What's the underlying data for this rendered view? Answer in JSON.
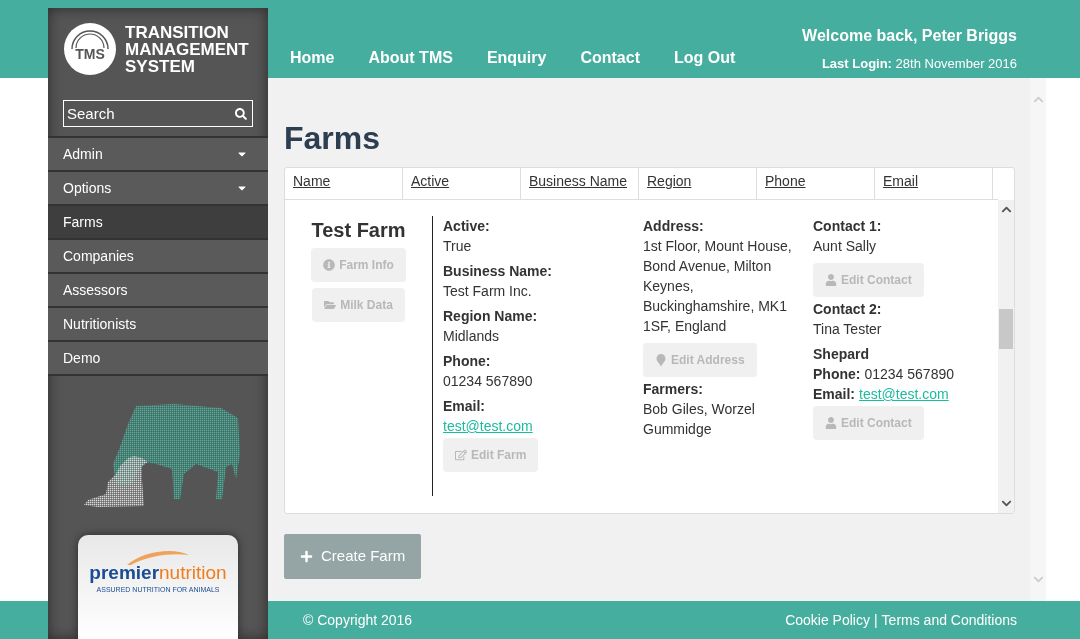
{
  "logo": {
    "badge": "TMS",
    "lines": [
      "TRANSITION",
      "MANAGEMENT",
      "SYSTEM"
    ]
  },
  "search": {
    "placeholder": "Search"
  },
  "sidebar": {
    "items": [
      {
        "label": "Admin",
        "has_menu": true,
        "selected": false
      },
      {
        "label": "Options",
        "has_menu": true,
        "selected": false
      },
      {
        "label": "Farms",
        "has_menu": false,
        "selected": true
      },
      {
        "label": "Companies",
        "has_menu": false,
        "selected": false
      },
      {
        "label": "Assessors",
        "has_menu": false,
        "selected": false
      },
      {
        "label": "Nutritionists",
        "has_menu": false,
        "selected": false
      },
      {
        "label": "Demo",
        "has_menu": false,
        "selected": false
      }
    ]
  },
  "sponsor": {
    "word_1": "premier",
    "word_2": "nutrition",
    "tagline": "ASSURED NUTRITION FOR ANIMALS"
  },
  "nav": [
    {
      "label": "Home"
    },
    {
      "label": "About TMS"
    },
    {
      "label": "Enquiry"
    },
    {
      "label": "Contact"
    },
    {
      "label": "Log Out"
    }
  ],
  "user": {
    "welcome": "Welcome back, Peter Briggs",
    "last_login_label": "Last Login:",
    "last_login": "28th November 2016"
  },
  "page_title": "Farms",
  "table": {
    "columns": [
      "Name",
      "Active",
      "Business Name",
      "Region",
      "Phone",
      "Email"
    ]
  },
  "farm": {
    "name": "Test Farm",
    "actions": [
      {
        "label": "Farm Info",
        "disabled": true
      },
      {
        "label": "Milk Data",
        "disabled": true
      }
    ],
    "columns": [
      [
        {
          "kind": "label",
          "text": "Active:"
        },
        {
          "kind": "value",
          "text": "True"
        },
        {
          "kind": "label",
          "text": "Business Name:"
        },
        {
          "kind": "value",
          "text": "Test Farm Inc."
        },
        {
          "kind": "label",
          "text": "Region Name:"
        },
        {
          "kind": "value",
          "text": "Midlands"
        },
        {
          "kind": "label",
          "text": "Phone:"
        },
        {
          "kind": "value",
          "text": "01234 567890"
        },
        {
          "kind": "label",
          "text": "Email:"
        },
        {
          "kind": "link",
          "text": "test@test.com"
        },
        {
          "kind": "farm_button",
          "text": "Edit Farm",
          "disabled": true
        }
      ],
      [
        {
          "kind": "label",
          "text": "Address:"
        },
        {
          "kind": "value",
          "text": "1st Floor, Mount House, Bond Avenue, Milton Keynes, Buckinghamshire, MK1 1SF, England"
        },
        {
          "kind": "address_button",
          "text": "Edit Address",
          "disabled": true
        },
        {
          "kind": "label",
          "text": "Farmers:"
        },
        {
          "kind": "value",
          "text": "Bob Giles, Worzel Gummidge"
        }
      ],
      [
        {
          "kind": "label",
          "text": "Contact 1:"
        },
        {
          "kind": "value",
          "text": "Aunt Sally"
        },
        {
          "kind": "contact_button",
          "text": "Edit Contact",
          "disabled": true
        },
        {
          "kind": "label",
          "text": "Contact 2:"
        },
        {
          "kind": "value",
          "text": "Tina Tester"
        },
        {
          "kind": "label",
          "text": "Shepard"
        },
        {
          "kind": "inline",
          "label": "Phone:",
          "text": "01234 567890",
          "link": false
        },
        {
          "kind": "inline",
          "label": "Email:",
          "text": "test@test.com",
          "link": true
        },
        {
          "kind": "contact_button",
          "text": "Edit Contact",
          "disabled": true
        }
      ]
    ]
  },
  "create_button": {
    "label": "Create Farm"
  },
  "footer": {
    "copyright": "© Copyright 2016",
    "links": [
      {
        "label": "Cookie Policy"
      },
      {
        "label": "Terms and Conditions"
      }
    ],
    "separator": "|"
  }
}
